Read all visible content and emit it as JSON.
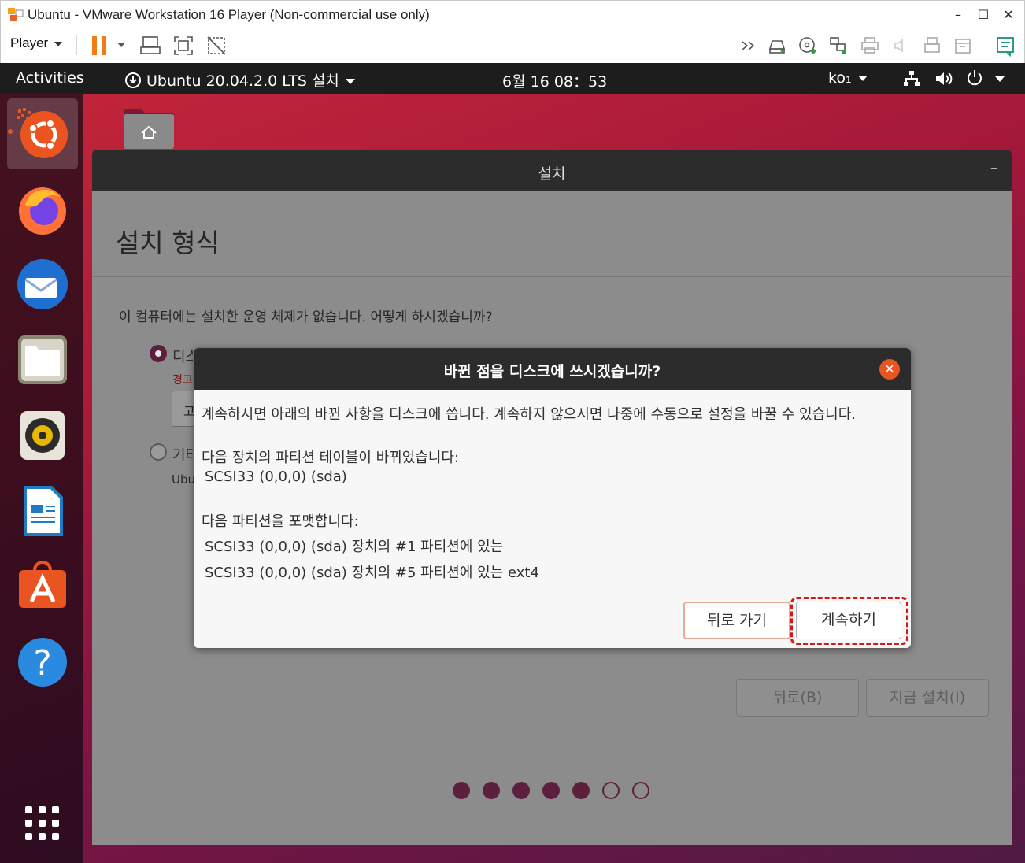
{
  "window": {
    "title": "Ubuntu - VMware Workstation 16 Player (Non-commercial use only)",
    "controls": {
      "minimize": "–",
      "maximize": "☐",
      "close": "✕"
    }
  },
  "toolbar": {
    "player_menu": "Player",
    "left_icons": [
      "pause-icon",
      "send-ctrl-alt-del-icon",
      "fullscreen-icon",
      "unity-icon"
    ],
    "device_icons": [
      "more-devices-icon",
      "hard-disk-icon",
      "cd-dvd-icon",
      "network-adapter-icon",
      "printer-icon",
      "sound-card-icon",
      "usb-icon",
      "floppy-icon",
      "message-log-icon"
    ]
  },
  "topbar": {
    "activities": "Activities",
    "app_menu": "Ubuntu 20.04.2.0 LTS 설치",
    "clock": "6월 16  08：53",
    "language": "ko₁"
  },
  "dock": {
    "items": [
      "ubuntu-installer-icon",
      "firefox-icon",
      "thunderbird-icon",
      "files-icon",
      "rhythmbox-icon",
      "libreoffice-writer-icon",
      "ubuntu-software-icon",
      "help-icon",
      "show-applications-icon"
    ]
  },
  "installer": {
    "window_title": "설치",
    "heading": "설치 형식",
    "question": "이 컴퓨터에는 설치한 운영 체제가 없습니다. 어떻게 하시겠습니까?",
    "option1_label": "디스",
    "option1_warning": "경고",
    "option1_box_text": "고",
    "option2_label": "기타",
    "option2_sub": "Ubu",
    "back_button": "뒤로(B)",
    "install_button": "지금 설치(I)",
    "progress": {
      "total": 7,
      "completed": 5
    }
  },
  "dialog": {
    "title": "바뀐 점을 디스크에 쓰시겠습니까?",
    "message": "계속하시면 아래의 바뀐 사항을 디스크에 씁니다. 계속하지 않으시면 나중에 수동으로 설정을 바꿀 수 있습니다.",
    "partition_table_heading": "다음 장치의 파티션 테이블이 바뀌었습니다:",
    "partition_table_device": "SCSI33 (0,0,0) (sda)",
    "format_heading": "다음 파티션을 포맷합니다:",
    "format_items": [
      "SCSI33 (0,0,0) (sda) 장치의 #1 파티션에 있는",
      "SCSI33 (0,0,0) (sda) 장치의 #5 파티션에 있는 ext4"
    ],
    "back_button": "뒤로 가기",
    "continue_button": "계속하기",
    "close_glyph": "✕"
  },
  "colors": {
    "ubuntu_orange": "#e95420",
    "aubergine": "#5c1f3d",
    "vmware_orange": "#f07c14",
    "highlight_red": "#d71818"
  }
}
